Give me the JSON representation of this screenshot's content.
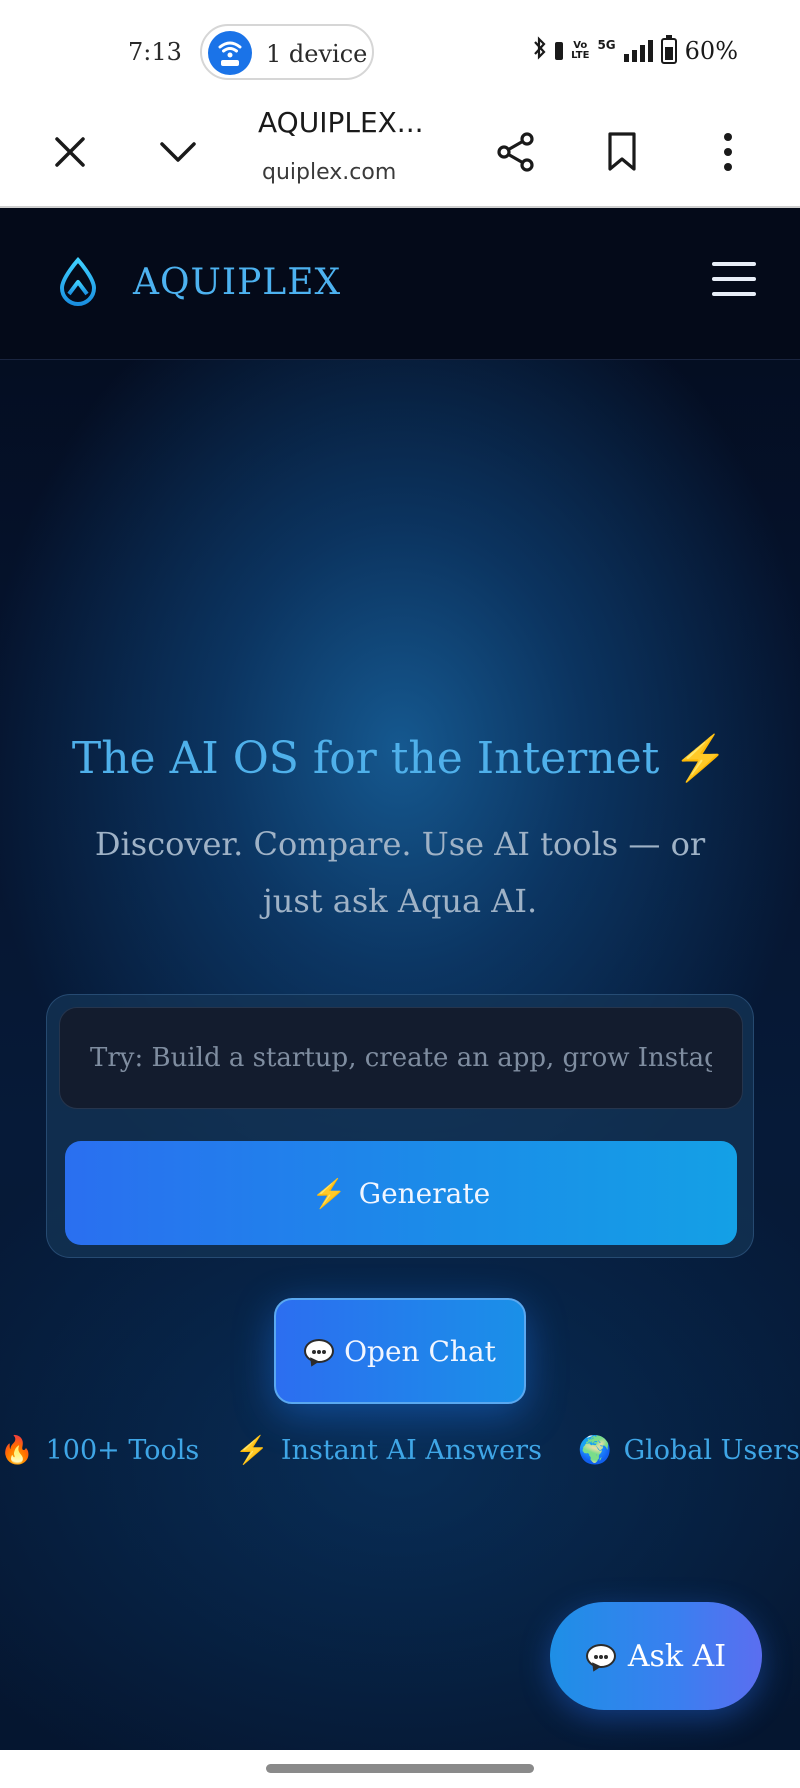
{
  "status_bar": {
    "time": "7:13",
    "device_label": "1 device",
    "fiveg": "5G",
    "battery": "60%",
    "battery_level": 0.6
  },
  "browser": {
    "page_title": "AQUIPLEX...",
    "url": "quiplex.com"
  },
  "site": {
    "brand": "AQUIPLEX",
    "accent_color": "#4db2f0"
  },
  "hero": {
    "title": "The AI OS for the Internet",
    "subtitle": "Discover. Compare. Use AI tools — or just ask Aqua AI."
  },
  "generator": {
    "placeholder": "Try: Build a startup, create an app, grow Instagram...",
    "generate_label": "Generate"
  },
  "open_chat_label": "Open Chat",
  "features": [
    {
      "icon": "fire-icon",
      "glyph": "🔥",
      "label": "100+ Tools"
    },
    {
      "icon": "lightning-icon",
      "glyph": "⚡",
      "label": "Instant AI Answers"
    },
    {
      "icon": "globe-icon",
      "glyph": "🌍",
      "label": "Global Users"
    }
  ],
  "ask_ai_label": "Ask AI"
}
